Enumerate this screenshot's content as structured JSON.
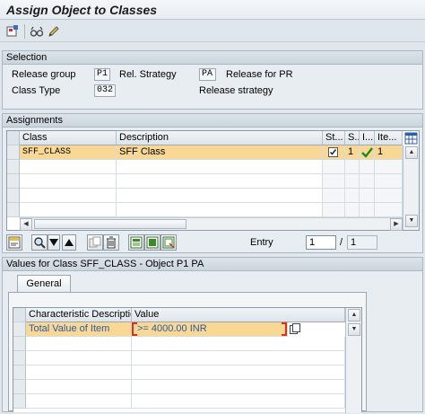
{
  "window": {
    "title": "Assign Object to Classes"
  },
  "toolbar": {
    "icons": [
      "save-layout-icon",
      "glasses-icon",
      "pencil-icon"
    ]
  },
  "selection": {
    "title": "Selection",
    "release_group_label": "Release group",
    "release_group_value": "P1",
    "rel_strategy_label": "Rel. Strategy",
    "rel_strategy_value": "PA",
    "rel_strategy_desc": "Release for PR",
    "class_type_label": "Class Type",
    "class_type_value": "032",
    "class_type_desc": "Release strategy"
  },
  "assignments": {
    "title": "Assignments",
    "columns": [
      "Class",
      "Description",
      "St...",
      "S...",
      "I...",
      "Ite..."
    ],
    "rows": [
      {
        "class": "SFF_CLASS",
        "description": "SFF Class",
        "st": "checked",
        "s": "1",
        "i": "check",
        "ite": "1"
      }
    ],
    "entry_label": "Entry",
    "entry_current": "1",
    "entry_sep": "/",
    "entry_total": "1"
  },
  "values": {
    "title": "Values for Class SFF_CLASS - Object P1 PA",
    "tab_label": "General",
    "columns": [
      "Characteristic Description",
      "Value"
    ],
    "rows": [
      {
        "char_desc": "Total Value of Item",
        "value": ">= 4000.00 INR"
      }
    ]
  },
  "colors": {
    "highlight": "#f8d894",
    "link": "#2a5aa8",
    "required": "#e03010"
  }
}
